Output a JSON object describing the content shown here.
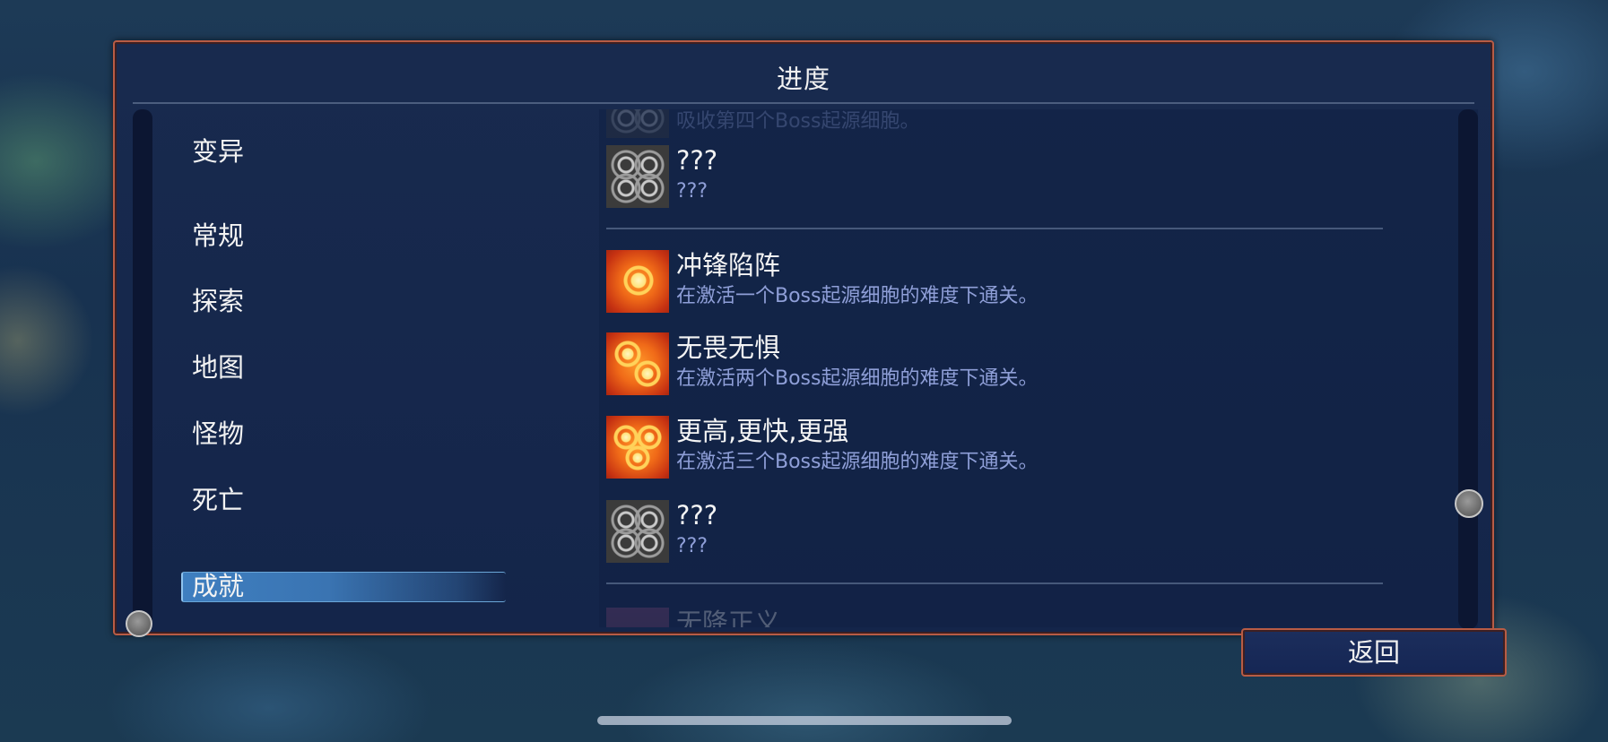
{
  "panel": {
    "title": "进度"
  },
  "categories": [
    {
      "label": "变异",
      "active": false
    },
    {
      "label": "常规",
      "active": false
    },
    {
      "label": "探索",
      "active": false
    },
    {
      "label": "地图",
      "active": false
    },
    {
      "label": "怪物",
      "active": false
    },
    {
      "label": "死亡",
      "active": false
    },
    {
      "label": "成就",
      "active": true
    }
  ],
  "achievements": [
    {
      "name": "",
      "desc": "吸收第四个Boss起源细胞。",
      "icon": "locked-cells-icon",
      "partial": true
    },
    {
      "name": "???",
      "desc": "???",
      "icon": "locked-cells-icon"
    },
    {
      "name": "冲锋陷阵",
      "desc": "在激活一个Boss起源细胞的难度下通关。",
      "icon": "one-boss-cell-icon"
    },
    {
      "name": "无畏无惧",
      "desc": "在激活两个Boss起源细胞的难度下通关。",
      "icon": "two-boss-cells-icon"
    },
    {
      "name": "更高,更快,更强",
      "desc": "在激活三个Boss起源细胞的难度下通关。",
      "icon": "three-boss-cells-icon"
    },
    {
      "name": "???",
      "desc": "???",
      "icon": "locked-cells-icon"
    },
    {
      "name": "无降正义",
      "desc": "",
      "icon": "pink-achievement-icon",
      "partial": true
    }
  ],
  "buttons": {
    "back": "返回"
  },
  "colors": {
    "frame": "#b85c45",
    "panel_bg": "#182a4e",
    "active_tab": "#3f7fc0",
    "desc_text": "#8f9fd8"
  }
}
